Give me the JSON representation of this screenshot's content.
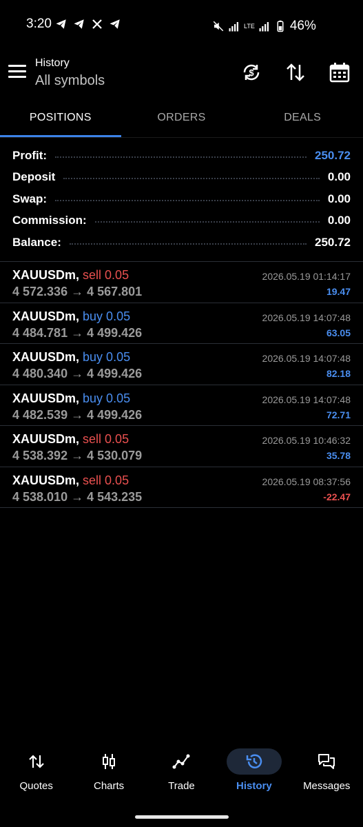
{
  "status_bar": {
    "time": "3:20",
    "battery": "46%",
    "network": "LTE"
  },
  "header": {
    "title": "History",
    "subtitle": "All symbols"
  },
  "tabs": [
    {
      "label": "POSITIONS",
      "active": true
    },
    {
      "label": "ORDERS",
      "active": false
    },
    {
      "label": "DEALS",
      "active": false
    }
  ],
  "summary": {
    "profit": {
      "label": "Profit:",
      "value": "250.72"
    },
    "deposit": {
      "label": "Deposit",
      "value": "0.00"
    },
    "swap": {
      "label": "Swap:",
      "value": "0.00"
    },
    "commission": {
      "label": "Commission:",
      "value": "0.00"
    },
    "balance": {
      "label": "Balance:",
      "value": "250.72"
    }
  },
  "positions": [
    {
      "symbol": "XAUUSDm,",
      "type": "sell 0.05",
      "side": "sell",
      "prices": "4 572.336 → 4 567.801",
      "time": "2026.05.19 01:14:17",
      "profit": "19.47"
    },
    {
      "symbol": "XAUUSDm,",
      "type": "buy 0.05",
      "side": "buy",
      "prices": "4 484.781 → 4 499.426",
      "time": "2026.05.19 14:07:48",
      "profit": "63.05"
    },
    {
      "symbol": "XAUUSDm,",
      "type": "buy 0.05",
      "side": "buy",
      "prices": "4 480.340 → 4 499.426",
      "time": "2026.05.19 14:07:48",
      "profit": "82.18"
    },
    {
      "symbol": "XAUUSDm,",
      "type": "buy 0.05",
      "side": "buy",
      "prices": "4 482.539 → 4 499.426",
      "time": "2026.05.19 14:07:48",
      "profit": "72.71"
    },
    {
      "symbol": "XAUUSDm,",
      "type": "sell 0.05",
      "side": "sell",
      "prices": "4 538.392 → 4 530.079",
      "time": "2026.05.19 10:46:32",
      "profit": "35.78"
    },
    {
      "symbol": "XAUUSDm,",
      "type": "sell 0.05",
      "side": "sell",
      "prices": "4 538.010 → 4 543.235",
      "time": "2026.05.19 08:37:56",
      "profit": "-22.47"
    }
  ],
  "bottom_nav": [
    {
      "label": "Quotes",
      "icon": "quotes-icon",
      "active": false
    },
    {
      "label": "Charts",
      "icon": "charts-icon",
      "active": false
    },
    {
      "label": "Trade",
      "icon": "trade-icon",
      "active": false
    },
    {
      "label": "History",
      "icon": "history-icon",
      "active": true
    },
    {
      "label": "Messages",
      "icon": "messages-icon",
      "active": false
    }
  ],
  "colors": {
    "accent": "#4a8ef0",
    "sell": "#e9504f",
    "background": "#000000"
  }
}
